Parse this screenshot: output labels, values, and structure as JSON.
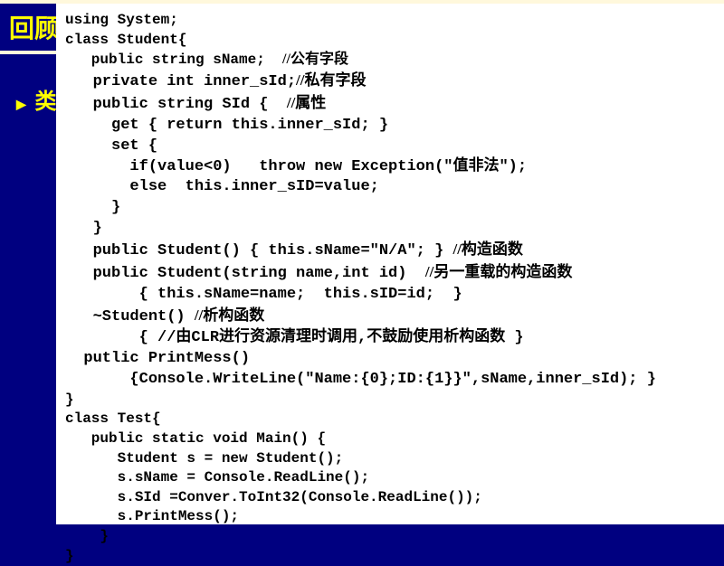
{
  "heading": "回顾",
  "bullet": "类",
  "code": {
    "l1": "using System;",
    "l2": "class Student{",
    "l3a": "   public string sName;  ",
    "l3b": "//公有字段",
    "l4a": "   private int inner_sId;",
    "l4b": "//私有字段",
    "l5a": "   public string SId {  ",
    "l5b": "//属性",
    "l6": "     get { return this.inner_sId; }",
    "l7": "     set {",
    "l8": "       if(value<0)   throw new Exception(\"值非法\");",
    "l9": "       else  this.inner_sID=value;",
    "l10": "     }",
    "l11": "   }",
    "l12a": "   public Student() { this.sName=\"N/A\"; } ",
    "l12b": "//构造函数",
    "l13a": "   public Student(string name,int id)  ",
    "l13b": "//另一重载的构造函数",
    "l14": "        { this.sName=name;  this.sID=id;  }",
    "l15a": "   ~Student() ",
    "l15b": "//析构函数",
    "l16": "        { //由CLR进行资源清理时调用,不鼓励使用析构函数 }",
    "l17": "  putlic PrintMess()",
    "l18": "       {Console.WriteLine(\"Name:{0};ID:{1}}\",sName,inner_sId); }",
    "l19": "}",
    "l20": "class Test{",
    "l21": "   public static void Main() {",
    "l22": "      Student s = new Student();",
    "l23": "      s.sName = Console.ReadLine();",
    "l24": "      s.SId =Conver.ToInt32(Console.ReadLine());",
    "l25": "      s.PrintMess();",
    "l26": "    }",
    "l27": "}"
  }
}
